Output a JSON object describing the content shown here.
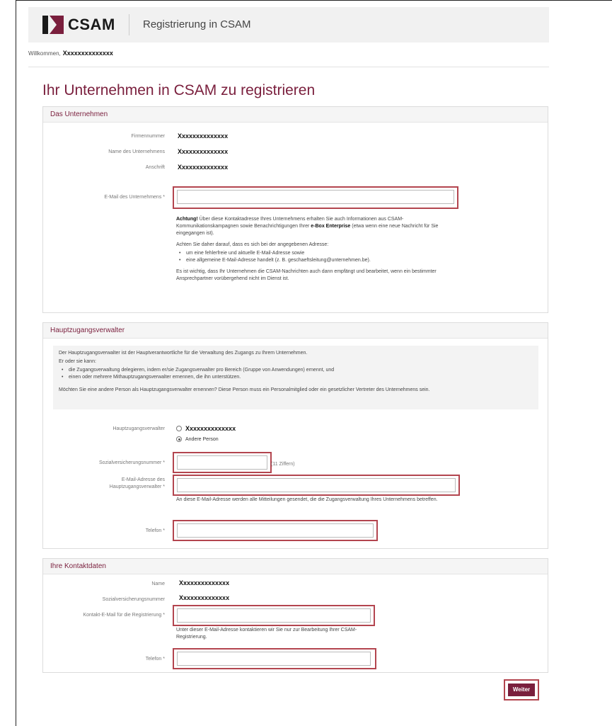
{
  "header": {
    "logo_text": "CSAM",
    "title": "Registrierung in CSAM"
  },
  "welcome": {
    "prefix": "Willkommen,",
    "name": "Xxxxxxxxxxxxxx"
  },
  "page_title": "Ihr Unternehmen in CSAM zu registrieren",
  "company": {
    "heading": "Das Unternehmen",
    "rows": [
      {
        "label": "Firmennummer",
        "value": "Xxxxxxxxxxxxxx"
      },
      {
        "label": "Name des Unternehmens",
        "value": "Xxxxxxxxxxxxxx"
      },
      {
        "label": "Anschrift",
        "value": "Xxxxxxxxxxxxxx"
      }
    ],
    "email_label": "E-Mail des Unternehmens *",
    "note_lead_bold": "Achtung!",
    "note_p1_a": " Über diese Kontaktadresse Ihres Unternehmens erhalten Sie auch Informationen aus CSAM-Kommunikationskampagnen sowie Benachrichtigungen Ihrer ",
    "note_p1_bold": "e-Box Enterprise",
    "note_p1_b": " (etwa wenn eine neue Nachricht für Sie eingegangen ist).",
    "note_p2": "Achten Sie daher darauf, dass es sich bei der angegebenen Adresse:",
    "note_bullets": [
      "um eine fehlerfreie und aktuelle E-Mail-Adresse sowie",
      "eine allgemeine E-Mail-Adresse handelt (z. B. geschaeftsleitung@unternehmen.be)."
    ],
    "note_p3": "Es ist wichtig, dass Ihr Unternehmen die CSAM-Nachrichten auch dann empfängt und bearbeitet, wenn ein bestimmter Ansprechpartner vorübergehend nicht im Dienst ist."
  },
  "admin": {
    "heading": "Hauptzugangsverwalter",
    "info_p1": "Der Hauptzugangsverwalter ist der Hauptverantwortliche für die Verwaltung des Zugangs zu Ihrem Unternehmen.",
    "info_p2": "Er oder sie kann:",
    "info_bullets": [
      "die Zugangsverwaltung delegieren, indem er/sie Zugangsverwalter pro Bereich (Gruppe von Anwendungen) ernennt, und",
      "einen oder mehrere Mithauptzugangsverwalter ernennen, die ihn unterstützen."
    ],
    "info_p3": "Möchten Sie eine andere Person als Hauptzugangsverwalter ernennen? Diese Person muss ein Personalmitglied oder ein gesetzlicher Vertreter des Unternehmens sein.",
    "admin_label": "Hauptzugangsverwalter",
    "option_self": "Xxxxxxxxxxxxxx",
    "option_other": "Andere Person",
    "ssn_label": "Sozialversicherungsnummer *",
    "ssn_hint": "(11 Ziffern)",
    "email_label_1": "E-Mail-Adresse des",
    "email_label_2": "Hauptzugangsverwalter *",
    "email_note": "An diese E-Mail-Adresse werden alle Mitteilungen gesendet, die die Zugangsverwaltung Ihres Unternehmens betreffen.",
    "phone_label": "Telefon *"
  },
  "contact": {
    "heading": "Ihre Kontaktdaten",
    "name_label": "Name",
    "name_value": "Xxxxxxxxxxxxxx",
    "ssn_label": "Sozialversicherungsnummer",
    "ssn_value": "Xxxxxxxxxxxxxx",
    "email_label": "Kontakt-E-Mail für die Registrierung *",
    "email_note": "Unter dieser E-Mail-Adresse kontaktieren wir Sie nur zur Bearbeitung Ihrer CSAM-Registrierung.",
    "phone_label": "Telefon *"
  },
  "submit_label": "Weiter",
  "colors": {
    "brand": "#7a1f3d",
    "highlight": "#b3454f"
  }
}
